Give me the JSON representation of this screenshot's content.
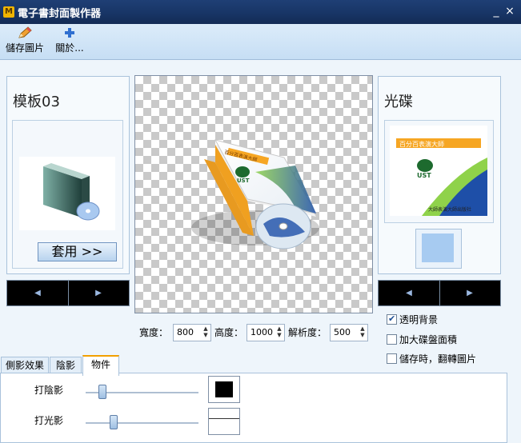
{
  "window": {
    "title": "電子書封面製作器",
    "minimize": "_",
    "close": "×",
    "app_icon": "M"
  },
  "toolbar": {
    "save_label": "儲存圖片",
    "save_icon": "pencil-icon",
    "about_label": "關於...",
    "about_icon": "plus-icon"
  },
  "left_panel": {
    "template_name": "模板03",
    "apply_label": "套用 >>"
  },
  "right_panel": {
    "item_name": "光碟"
  },
  "cover_text": {
    "title": "百分百表演大師",
    "logo": "UST",
    "small": "大師表演大師出版社"
  },
  "nav": {
    "prev": "◀",
    "next": "▶"
  },
  "size": {
    "width_label": "寬度：",
    "width_value": "800",
    "height_label": "高度：",
    "height_value": "1000",
    "dpi_label": "解析度：",
    "dpi_value": "500"
  },
  "options": [
    {
      "label": "透明背景",
      "checked": true
    },
    {
      "label": "加大碟盤面積",
      "checked": false
    },
    {
      "label": "儲存時，翻轉圖片",
      "checked": false
    }
  ],
  "tabs": [
    {
      "label": "側影效果",
      "active": false
    },
    {
      "label": "陰影",
      "active": false
    },
    {
      "label": "物件",
      "active": true
    }
  ],
  "sliders": [
    {
      "label": "打陰影",
      "value": 0.15,
      "color": "#000000"
    },
    {
      "label": "打光影",
      "value": 0.25,
      "color": "#ffffff"
    }
  ],
  "colors": {
    "titlebar": "#1a3a6e",
    "accent": "#f2a000",
    "panel_bg": "#eef5fb"
  }
}
